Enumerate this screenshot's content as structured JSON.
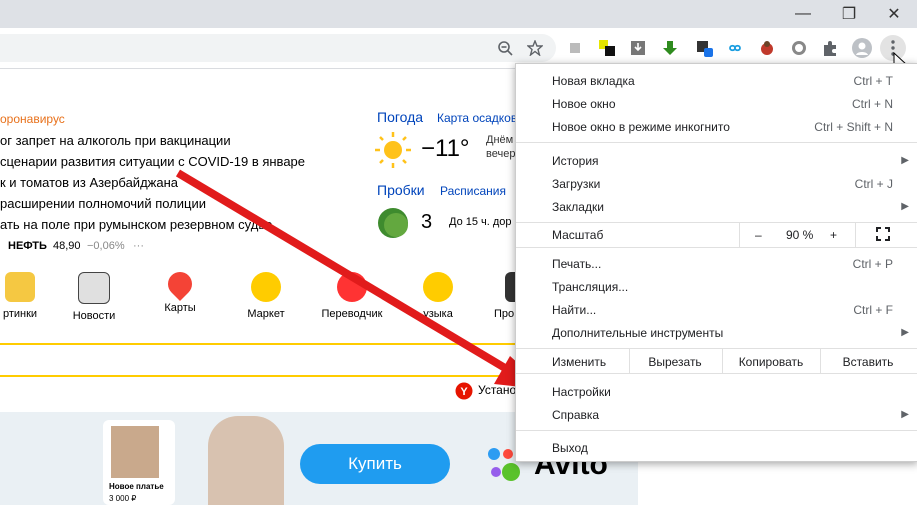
{
  "browser": {
    "window_buttons": [
      "—",
      "❐",
      "✕"
    ],
    "toolbar_icons": [
      "zoom-out-icon",
      "star-icon",
      "extension-icon",
      "extension-icon",
      "download-icon",
      "arrow-down-icon",
      "package-icon",
      "infinity-icon",
      "ladybug-icon",
      "whatsapp-icon",
      "puzzle-icon",
      "profile-icon",
      "menu-dots-icon"
    ]
  },
  "news": {
    "tag": "оронавирус",
    "items": [
      "ог запрет на алкоголь при вакцинации",
      "сценарии развития ситуации с COVID-19 в январе",
      "к и томатов из Азербайджана",
      "расширении полномочий полиции",
      "ать на поле при румынском резервном судье"
    ],
    "ticker_label": "НЕФТЬ",
    "ticker_value": "48,90",
    "ticker_change": "−0,06%",
    "ticker_more": "···"
  },
  "weather": {
    "title": "Погода",
    "link": "Карта осадков",
    "temp": "−11°",
    "forecast_1": "Днём",
    "forecast_2": "вечер"
  },
  "traffic": {
    "title": "Пробки",
    "link": "Расписания",
    "score": "3",
    "note": "До 15 ч. дор"
  },
  "services": [
    {
      "label": "ртинки",
      "color": "#f5c842"
    },
    {
      "label": "Новости",
      "color": "#e0e0e0"
    },
    {
      "label": "Карты",
      "color": "#f44336"
    },
    {
      "label": "Маркет",
      "color": "#ffcc00"
    },
    {
      "label": "Переводчик",
      "color": "#ff3333"
    },
    {
      "label": "узыка",
      "color": "#ffcc00"
    },
    {
      "label": "Про",
      "color": "#333333"
    }
  ],
  "browser_promo": "Устано",
  "ad": {
    "product": "Новое платье",
    "price": "3 000 ₽",
    "buy": "Купить",
    "brand": "Avito"
  },
  "menu": {
    "new_tab": "Новая вкладка",
    "new_tab_sc": "Ctrl + T",
    "new_window": "Новое окно",
    "new_window_sc": "Ctrl + N",
    "incognito": "Новое окно в режиме инкогнито",
    "incognito_sc": "Ctrl + Shift + N",
    "history": "История",
    "downloads": "Загрузки",
    "downloads_sc": "Ctrl + J",
    "bookmarks": "Закладки",
    "zoom": "Масштаб",
    "zoom_minus": "–",
    "zoom_value": "90 %",
    "zoom_plus": "+",
    "print": "Печать...",
    "print_sc": "Ctrl + P",
    "cast": "Трансляция...",
    "find": "Найти...",
    "find_sc": "Ctrl + F",
    "more_tools": "Дополнительные инструменты",
    "edit": "Изменить",
    "cut": "Вырезать",
    "copy": "Копировать",
    "paste": "Вставить",
    "settings": "Настройки",
    "help": "Справка",
    "exit": "Выход"
  },
  "colors": {
    "arrow": "#e11b1b",
    "accent": "#1a73e8",
    "menu_bg": "#ffffff"
  }
}
